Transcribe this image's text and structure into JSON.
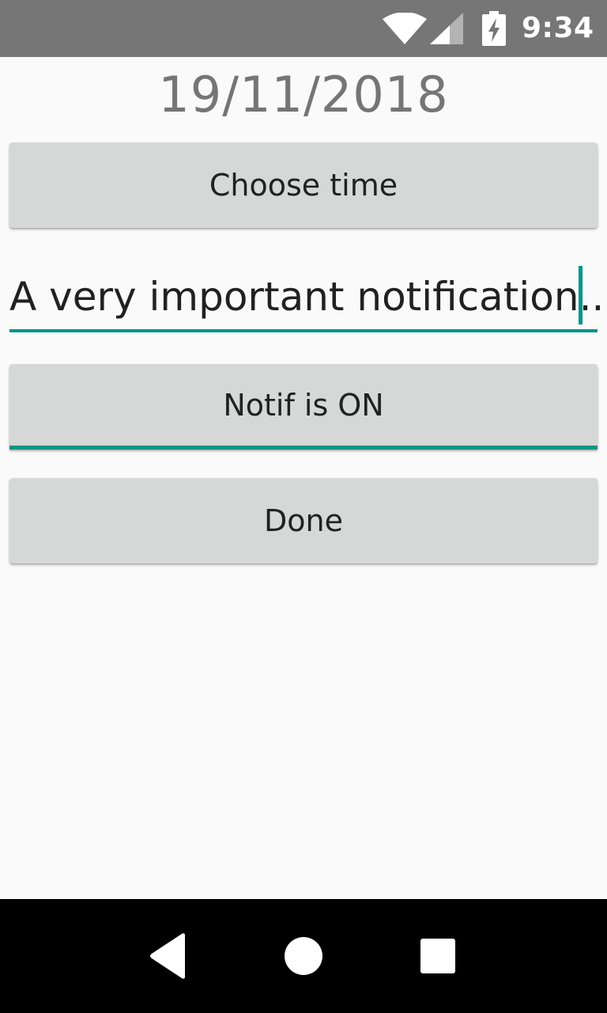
{
  "status_bar": {
    "time": "9:34",
    "icons": [
      "wifi-icon",
      "cell-signal-icon",
      "battery-charging-icon"
    ]
  },
  "main": {
    "date": "19/11/2018",
    "choose_time_label": "Choose time",
    "notification_text": "A very important notification...",
    "notif_toggle_label": "Notif is ON",
    "done_label": "Done"
  },
  "nav_bar": {
    "icons": [
      "back-icon",
      "home-icon",
      "recents-icon"
    ]
  },
  "colors": {
    "accent": "#009688",
    "status_bar": "#767676",
    "background": "#fafafa",
    "button": "#d6d7d7",
    "nav_bar": "#000000"
  }
}
